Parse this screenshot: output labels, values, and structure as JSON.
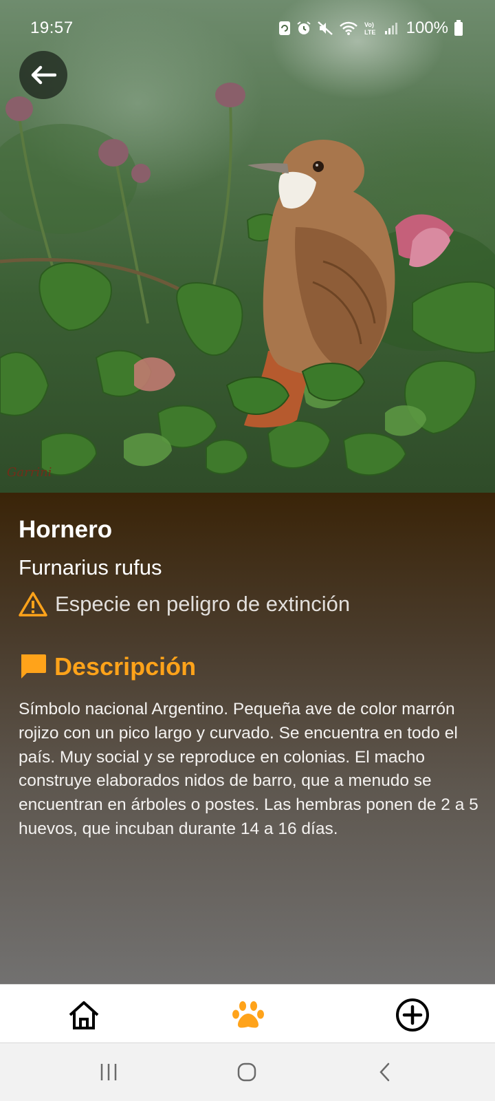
{
  "status_bar": {
    "time": "19:57",
    "battery": "100%",
    "icons": [
      "sync-icon",
      "alarm-icon",
      "mute-icon",
      "wifi-icon",
      "volte-icon",
      "signal-icon",
      "battery-icon"
    ]
  },
  "photo": {
    "subject": "bird-photo",
    "credit": "Garrini"
  },
  "bird": {
    "name": "Hornero",
    "scientific_name": "Furnarius rufus",
    "status": "Especie en peligro de extinción"
  },
  "description": {
    "title": "Descripción",
    "text": "Símbolo nacional Argentino. Pequeña ave de color marrón rojizo con un pico largo y curvado. Se encuentra en todo el país. Muy social y se reproduce en colonias. El macho construye elaborados nidos de barro, que a menudo se encuentran en árboles o postes. Las hembras ponen de 2 a 5 huevos, que incuban durante 14 a 16 días."
  },
  "bottom_nav": {
    "items": [
      {
        "icon": "home-icon",
        "active": false
      },
      {
        "icon": "paw-icon",
        "active": true
      },
      {
        "icon": "add-circle-icon",
        "active": false
      }
    ]
  },
  "colors": {
    "accent": "#ffa31a",
    "warning": "#ffa31a",
    "panel_top": "#3a2408",
    "panel_bottom": "#727170"
  }
}
